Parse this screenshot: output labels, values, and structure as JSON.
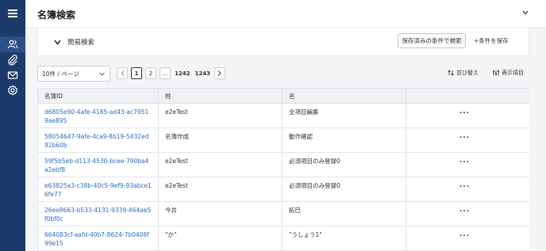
{
  "header": {
    "title": "名簿検索"
  },
  "rail": {
    "icons": [
      "menu-icon",
      "users-icon",
      "paperclip-icon",
      "mail-icon",
      "gear-icon"
    ]
  },
  "search": {
    "simple_label": "簡易検索",
    "saved_conditions_button": "保存済みの条件で検索",
    "save_conditions_button": "+条件を保存"
  },
  "toolbar": {
    "per_page": "10件 / ページ",
    "pages": [
      "1",
      "2",
      "...",
      "1242",
      "1243"
    ],
    "current_page": "1",
    "sort_label": "並び替え",
    "columns_label": "表示項目"
  },
  "table": {
    "columns": [
      "名簿ID",
      "姓",
      "名",
      ""
    ],
    "rows": [
      {
        "id": "d6805e90-4afe-4185-ad43-ac79519ae895",
        "sei": "e2eTest",
        "mei": "全項目編集",
        "more": "..."
      },
      {
        "id": "58054647-9afe-4ca9-8b19-5432ed92b60b",
        "sei": "名簿作成",
        "mei": "動作確認",
        "more": "..."
      },
      {
        "id": "59f5b5eb-d113-4530-bcee-790ba4a2ebf8",
        "sei": "e2eTest",
        "mei": "必須項目のみ登録0",
        "more": "..."
      },
      {
        "id": "e63825a3-c38b-40c5-9ef9-93abce16fe77",
        "sei": "e2eTest",
        "mei": "必須項目のみ登録0",
        "more": "..."
      },
      {
        "id": "26ee8663-b533-4131-9339-464ae5f0bf0c",
        "sei": "今井",
        "mei": "拓巳",
        "more": "..."
      },
      {
        "id": "664083cf-aafd-40b7-8624-7b0408f99e15",
        "sei": "\"か\"",
        "mei": "\"うしょう1\"",
        "more": "..."
      }
    ]
  }
}
